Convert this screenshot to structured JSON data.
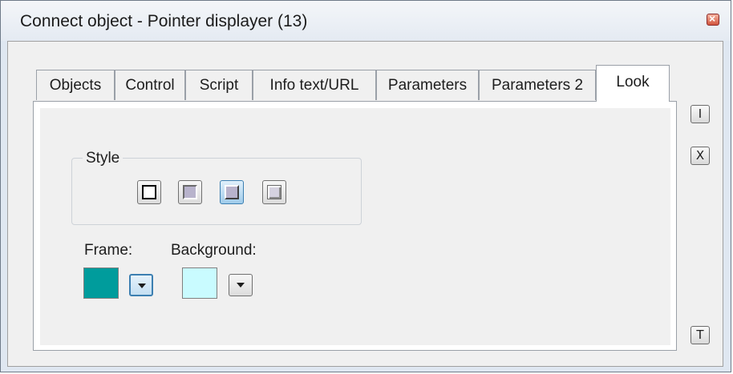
{
  "window": {
    "title": "Connect object - Pointer displayer (13)",
    "close_icon": "close-icon"
  },
  "tabs": [
    {
      "label": "Objects",
      "active": false
    },
    {
      "label": "Control",
      "active": false
    },
    {
      "label": "Script",
      "active": false
    },
    {
      "label": "Info text/URL",
      "active": false
    },
    {
      "label": "Parameters",
      "active": false
    },
    {
      "label": "Parameters 2",
      "active": false
    },
    {
      "label": "Look",
      "active": true
    }
  ],
  "style_group": {
    "label": "Style",
    "options": [
      {
        "name": "plain-frame",
        "selected": false
      },
      {
        "name": "sunken-frame",
        "selected": false
      },
      {
        "name": "raised-frame",
        "selected": true
      },
      {
        "name": "bevel-frame",
        "selected": false
      }
    ]
  },
  "colors": {
    "frame_label": "Frame:",
    "frame_color": "#009c9c",
    "background_label": "Background:",
    "background_color": "#c9fbff"
  },
  "side_buttons": [
    {
      "label": "I",
      "icon": "info-icon"
    },
    {
      "label": "X",
      "icon": "cancel-icon"
    },
    {
      "label": "T",
      "icon": "text-icon"
    }
  ]
}
